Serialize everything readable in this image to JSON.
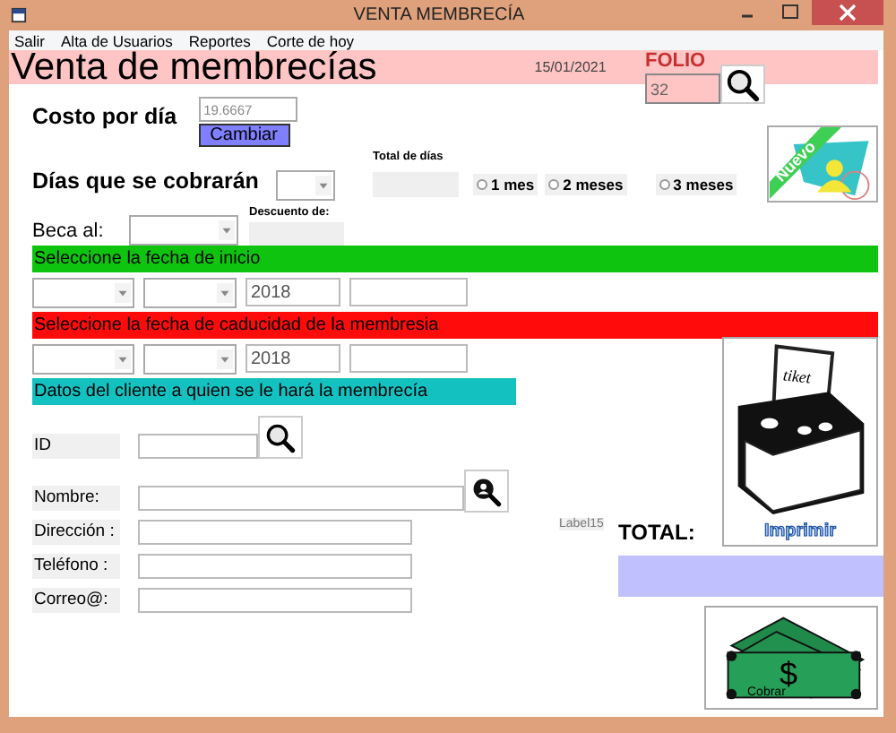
{
  "window": {
    "title": "VENTA MEMBRECÍA"
  },
  "menu": [
    "Salir",
    "Alta de Usuarios",
    "Reportes",
    "Corte de hoy"
  ],
  "header": {
    "title": "Venta de membrecías",
    "date": "15/01/2021"
  },
  "folio": {
    "label": "FOLIO",
    "value": "32"
  },
  "cost": {
    "label": "Costo por día",
    "value": "19.6667",
    "button": "Cambiar"
  },
  "days": {
    "label": "Días que se cobrarán",
    "total_label": "Total de días"
  },
  "periods": [
    {
      "label": "1 mes",
      "selected": false
    },
    {
      "label": "2 meses",
      "selected": false
    },
    {
      "label": "3 meses",
      "selected": false
    }
  ],
  "new_button": {
    "label": "Nuevo"
  },
  "scholarship": {
    "label": "Beca al:",
    "discount_label": "Descuento de:"
  },
  "start": {
    "heading": "Seleccione la fecha de inicio",
    "year": "2018"
  },
  "end": {
    "heading": "Seleccione la fecha de caducidad de la membresia",
    "year": "2018"
  },
  "client": {
    "heading": "Datos del cliente a quien se le hará la membrecía",
    "fields": [
      {
        "label": "ID",
        "kind": "search"
      },
      {
        "label": "Nombre:",
        "kind": "person-search"
      },
      {
        "label": "Dirección :",
        "kind": "plain"
      },
      {
        "label": "Teléfono :",
        "kind": "plain"
      },
      {
        "label": "Correo@:",
        "kind": "plain"
      }
    ]
  },
  "print_button": {
    "ticket": "tiket",
    "label": "Imprimir"
  },
  "total": {
    "placeholder_label": "Label15",
    "label": "TOTAL:"
  },
  "charge_button": {
    "symbol": "$",
    "label": "Cobrar"
  }
}
